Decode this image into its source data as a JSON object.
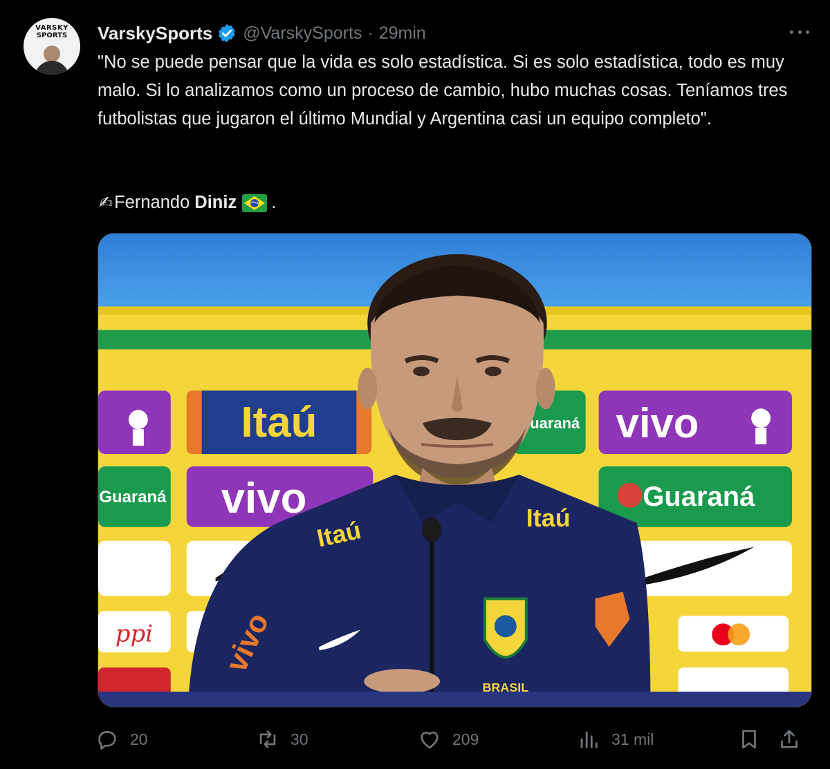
{
  "author": {
    "display_name": "VarskySports",
    "handle": "@VarskySports",
    "separator": "·",
    "time": "29min",
    "avatar_text_line1": "VARSKY",
    "avatar_text_line2": "SPORTS",
    "verified_color": "#1d9bf0"
  },
  "tweet": {
    "quote": "\"No se puede pensar que la vida es solo estadística. Si es solo estadística, todo es muy malo. Si lo analizamos como un proceso de cambio, hubo muchas cosas. Teníamos tres futbolistas que jugaron el último Mundial y Argentina casi un equipo completo\".",
    "credit_emoji": "✍",
    "credit_first_name": "Fernando",
    "credit_last_name": "Diniz",
    "credit_end": "."
  },
  "media": {
    "sponsors": [
      "Itaú",
      "vivo",
      "vivo",
      "Guaraná",
      "Guaraná",
      "Guaraná",
      "Itaú",
      "Itaú",
      "vivo",
      "ppi",
      "BRASIL"
    ]
  },
  "actions": {
    "replies": "20",
    "retweets": "30",
    "likes": "209",
    "views": "31 mil"
  },
  "icons": [
    "more-icon",
    "verified-icon",
    "writing-hand-icon",
    "brazil-flag-icon",
    "reply-icon",
    "retweet-icon",
    "like-icon",
    "views-icon",
    "bookmark-icon",
    "share-icon"
  ],
  "colors": {
    "background": "#000000",
    "text": "#e7e9ea",
    "muted": "#71767b",
    "accent": "#1d9bf0"
  }
}
